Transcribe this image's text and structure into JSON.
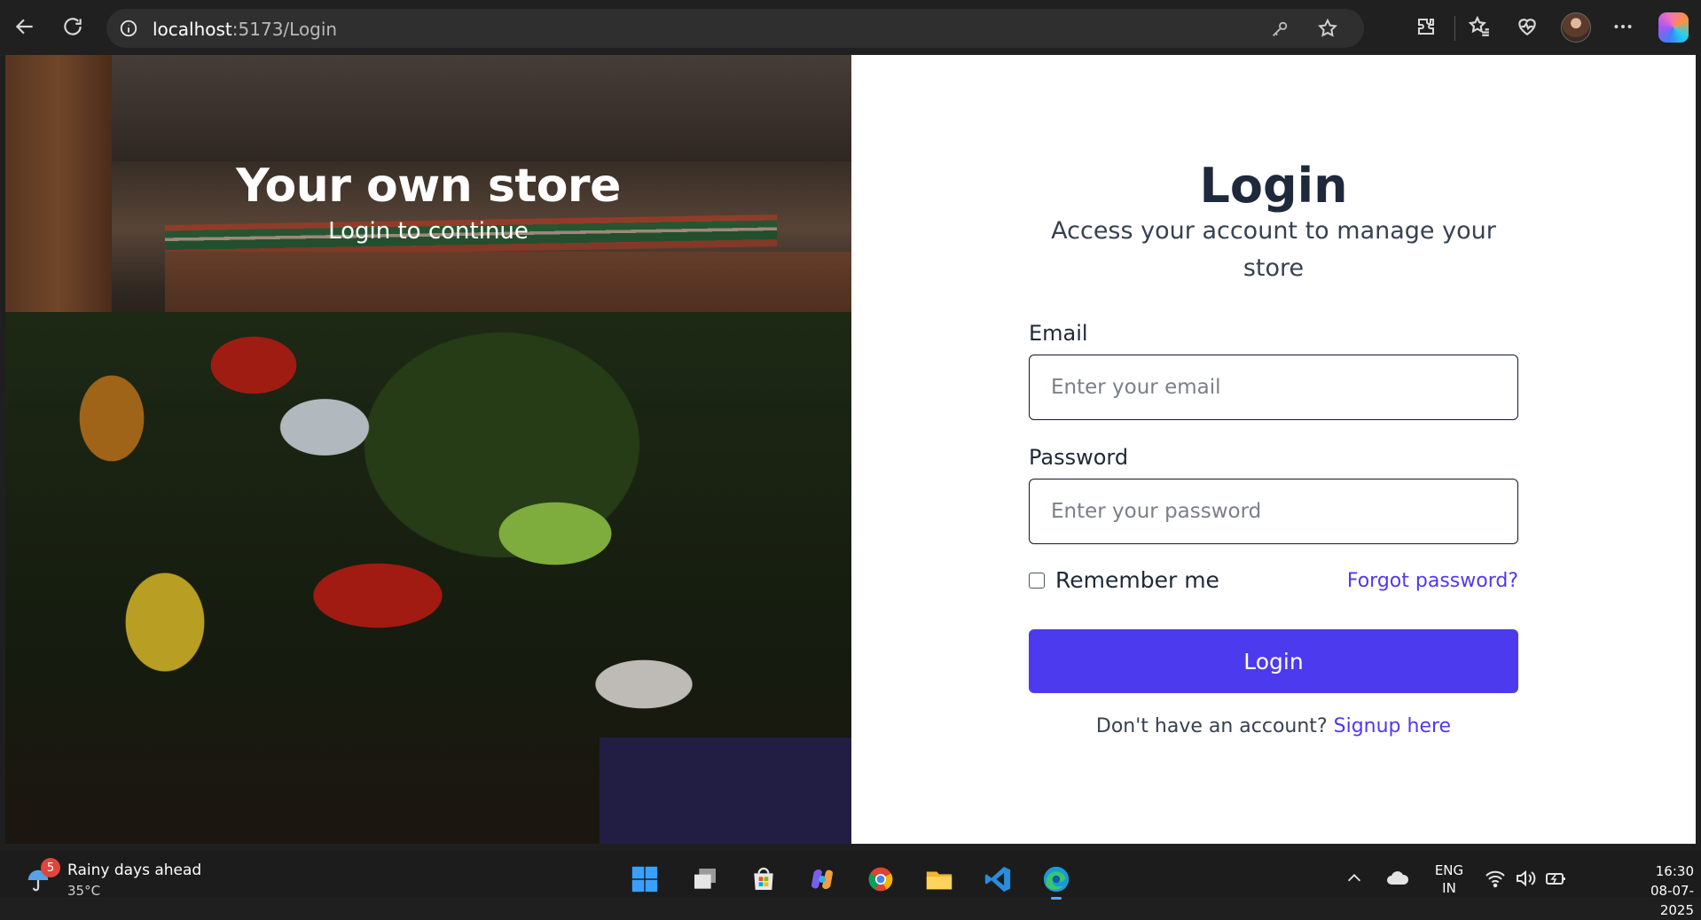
{
  "browser": {
    "url_host": "localhost",
    "url_rest": ":5173/Login"
  },
  "hero": {
    "title": "Your own store",
    "subtitle": "Login to continue"
  },
  "login": {
    "title": "Login",
    "subtitle": "Access your account to manage your store",
    "email_label": "Email",
    "email_placeholder": "Enter your email",
    "password_label": "Password",
    "password_placeholder": "Enter your password",
    "remember_label": "Remember me",
    "forgot_link": "Forgot password?",
    "submit_label": "Login",
    "signup_prompt": "Don't have an account?",
    "signup_link": "Signup here",
    "colors": {
      "primary": "#4c3aef",
      "heading": "#1e293b"
    }
  },
  "taskbar": {
    "weather_badge": "5",
    "weather_title": "Rainy days ahead",
    "weather_temp": "35°C",
    "lang_line1": "ENG",
    "lang_line2": "IN",
    "time": "16:30",
    "date": "08-07-2025"
  }
}
